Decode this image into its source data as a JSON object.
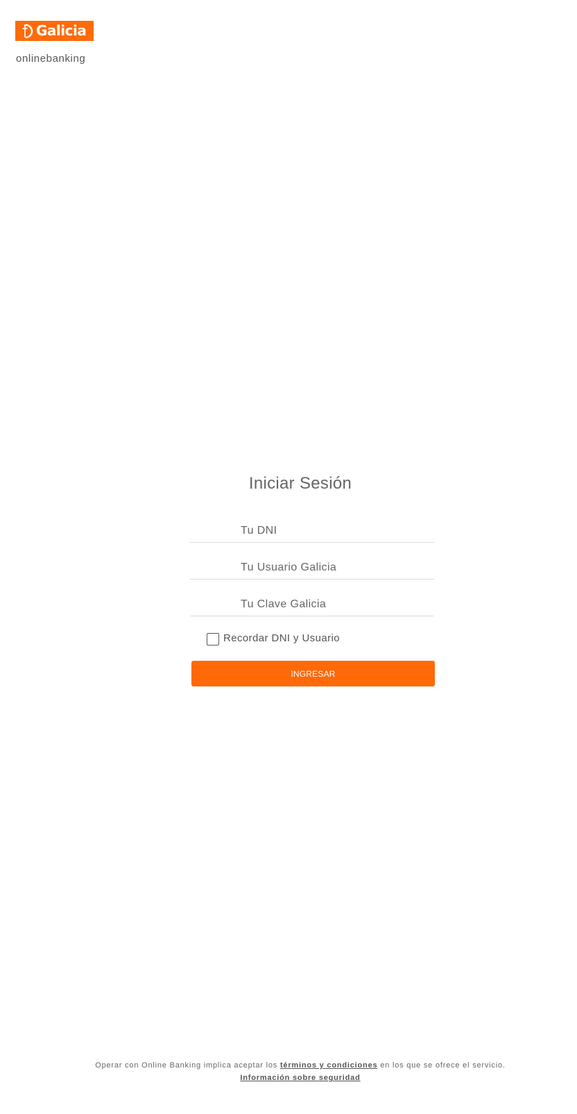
{
  "brand": {
    "logo_text": "Galicia",
    "tagline": "onlinebanking",
    "accent_color": "#ff6b08"
  },
  "login": {
    "title": "Iniciar Sesión",
    "dni_placeholder": "Tu DNI",
    "user_placeholder": "Tu Usuario Galicia",
    "password_placeholder": "Tu Clave Galicia",
    "remember_label": "Recordar DNI y Usuario",
    "remember_checked": false,
    "submit_label": "INGRESAR"
  },
  "footer": {
    "text_before": "Operar con Online Banking implica aceptar los ",
    "terms_link": "términos y condiciones",
    "text_after": " en los que se ofrece el servicio.",
    "security_link": "Información sobre seguridad"
  }
}
